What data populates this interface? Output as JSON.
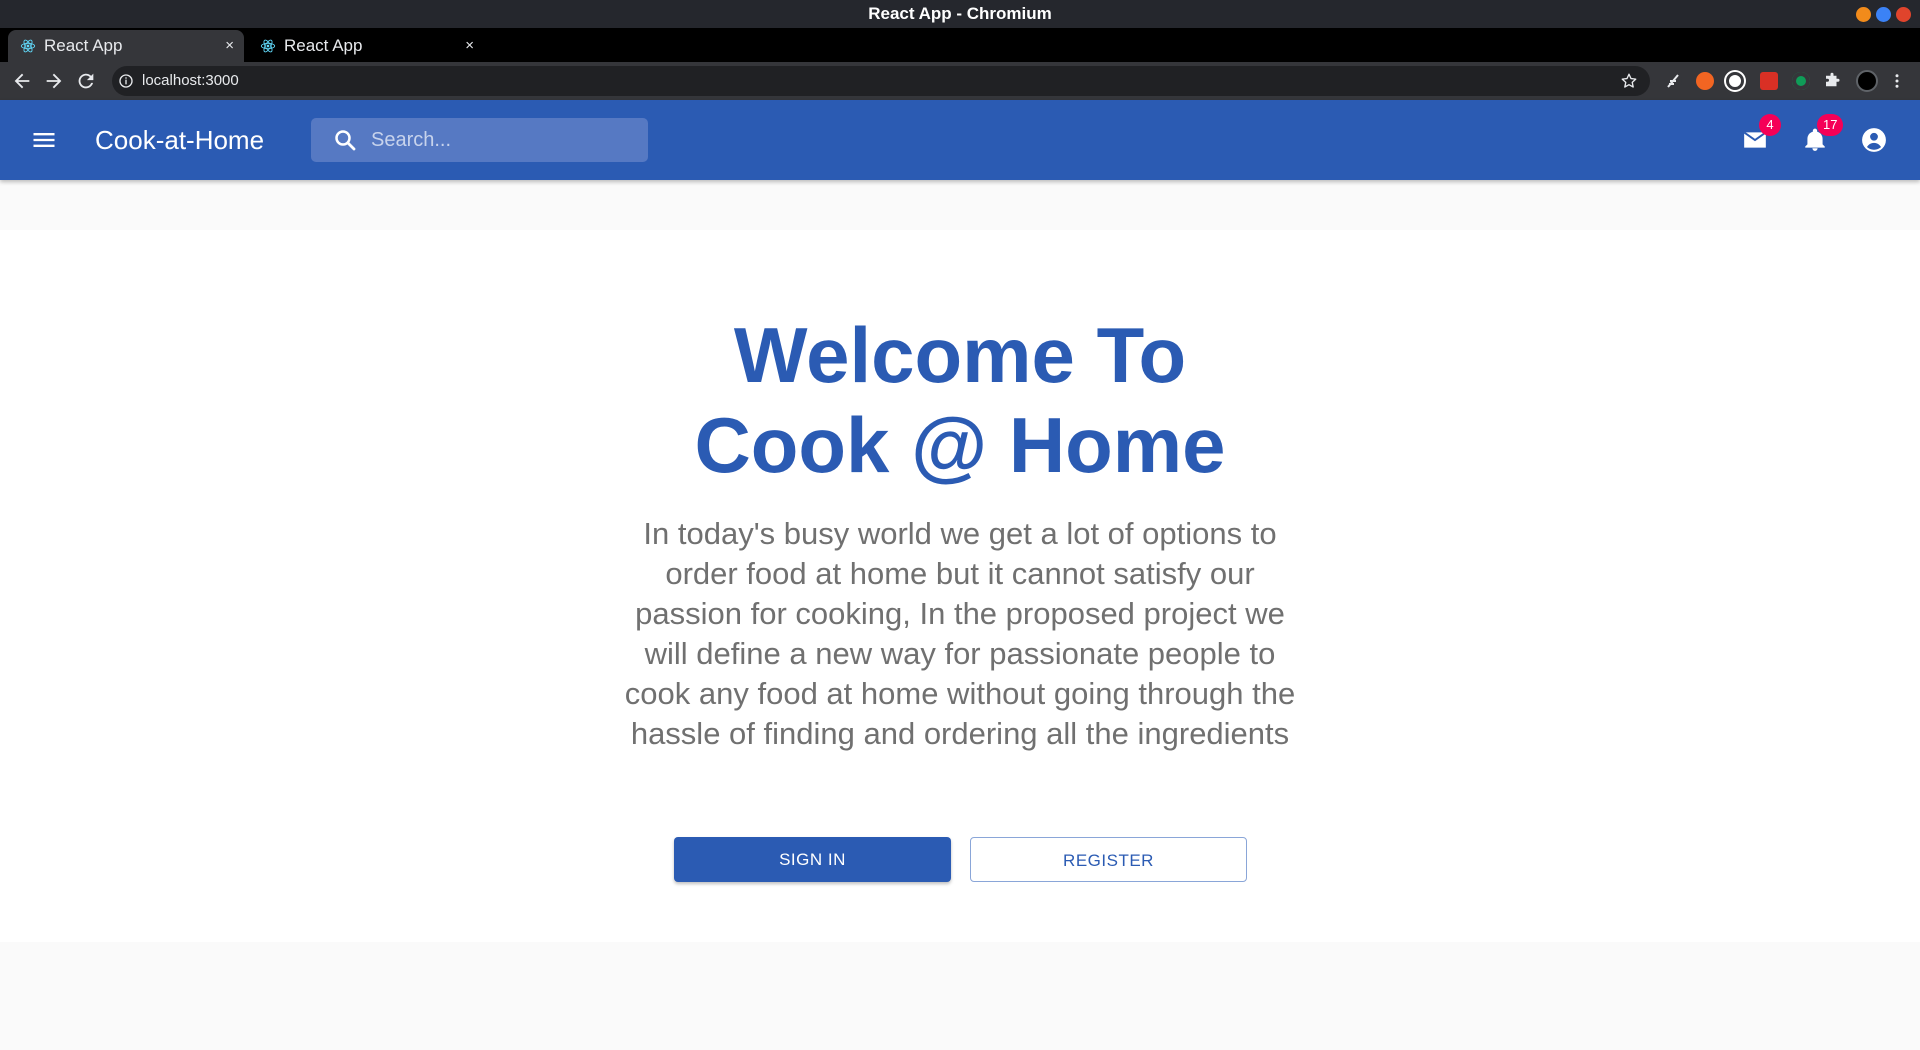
{
  "window": {
    "title": "React App - Chromium"
  },
  "tabs": [
    {
      "label": "React App",
      "active": true
    },
    {
      "label": "React App",
      "active": false
    }
  ],
  "tab_close_glyph": "×",
  "new_tab_glyph": "+",
  "address_bar": {
    "url": "localhost:3000"
  },
  "appbar": {
    "brand": "Cook-at-Home",
    "search_placeholder": "Search...",
    "mail_badge": "4",
    "notifications_badge": "17",
    "color": "#2b5bb3"
  },
  "hero": {
    "title_line1": "Welcome To",
    "title_line2": "Cook @ Home",
    "description": "In today's busy world we get a lot of options to order food at home but it cannot satisfy our passion for cooking, In the proposed project we will define a new way for passionate people to cook any food at home without going through the hassle of finding and ordering all the ingredients",
    "signin_label": "SIGN IN",
    "register_label": "REGISTER"
  },
  "colors": {
    "accent": "#2b5bb3",
    "badge": "#f50057",
    "body_text": "#707070"
  },
  "icons": {
    "menu": "menu-icon",
    "search": "search-icon",
    "mail": "mail-icon",
    "notifications": "bell-icon",
    "account": "account-circle-icon"
  }
}
